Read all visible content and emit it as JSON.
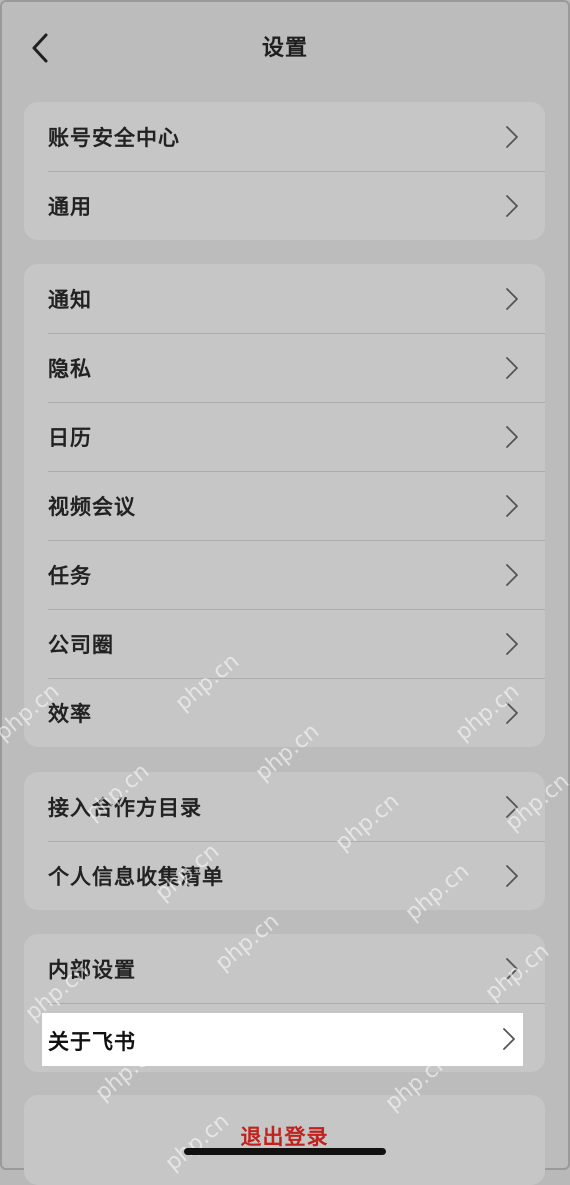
{
  "header": {
    "title": "设置",
    "back_icon": "chevron-left-icon"
  },
  "groups": [
    {
      "items": [
        {
          "label": "账号安全中心"
        },
        {
          "label": "通用"
        }
      ]
    },
    {
      "items": [
        {
          "label": "通知"
        },
        {
          "label": "隐私"
        },
        {
          "label": "日历"
        },
        {
          "label": "视频会议"
        },
        {
          "label": "任务"
        },
        {
          "label": "公司圈"
        },
        {
          "label": "效率"
        }
      ]
    },
    {
      "items": [
        {
          "label": "接入合作方目录"
        },
        {
          "label": "个人信息收集清单"
        }
      ]
    },
    {
      "items": [
        {
          "label": "内部设置"
        },
        {
          "label": "关于飞书"
        }
      ]
    }
  ],
  "logout": {
    "label": "退出登录"
  },
  "watermark": "php.cn",
  "colors": {
    "background": "#bcbcbc",
    "card": "#c6c6c6",
    "logout_text": "#c0231d",
    "highlight": "#ffffff"
  }
}
